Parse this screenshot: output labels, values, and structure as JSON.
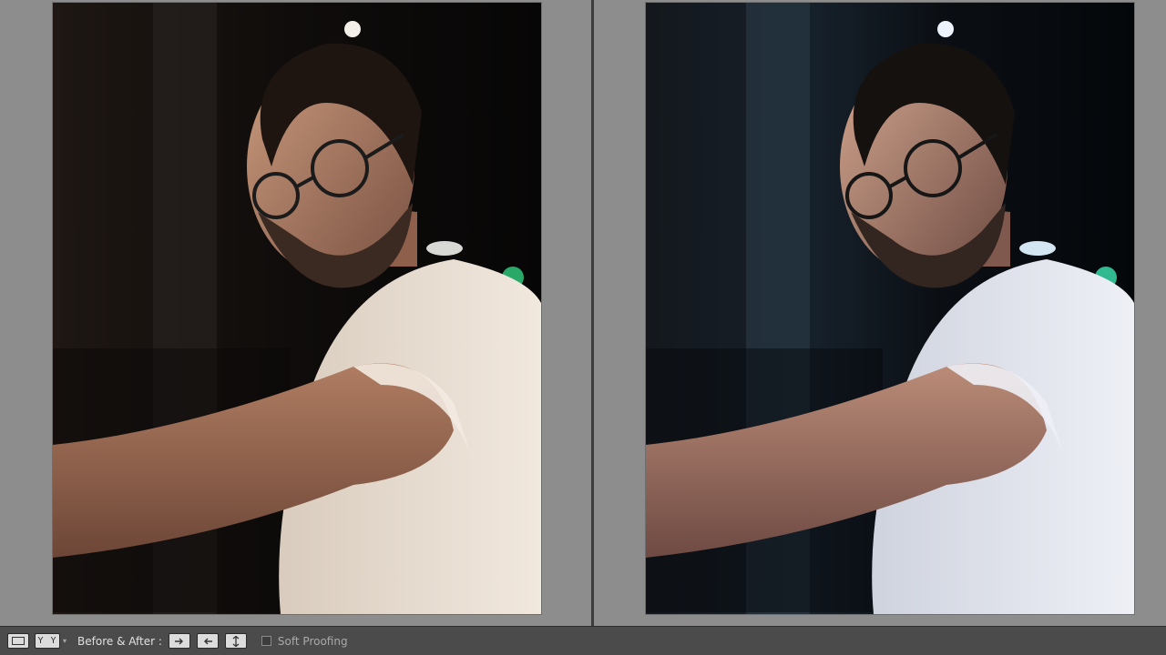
{
  "view": {
    "mode": "Before & After",
    "layout": "left-right",
    "photos": [
      {
        "name": "before",
        "tone": "warm"
      },
      {
        "name": "after",
        "tone": "cool-teal"
      }
    ]
  },
  "toolbar": {
    "loupe_icon": "loupe-view-icon",
    "yy_label": "Y Y",
    "yy_caret": "▾",
    "before_after_label": "Before & After :",
    "copy_before_icon": "arrow-right-icon",
    "copy_after_icon": "arrow-left-icon",
    "swap_icon": "swap-icon",
    "soft_proofing_label": "Soft Proofing",
    "soft_proofing_checked": false
  },
  "colors": {
    "panel_bg": "#8d8d8d",
    "toolbar_bg": "#4b4b4b",
    "shirt_before": "#e9dfd4",
    "shirt_after": "#e6e8f0"
  }
}
